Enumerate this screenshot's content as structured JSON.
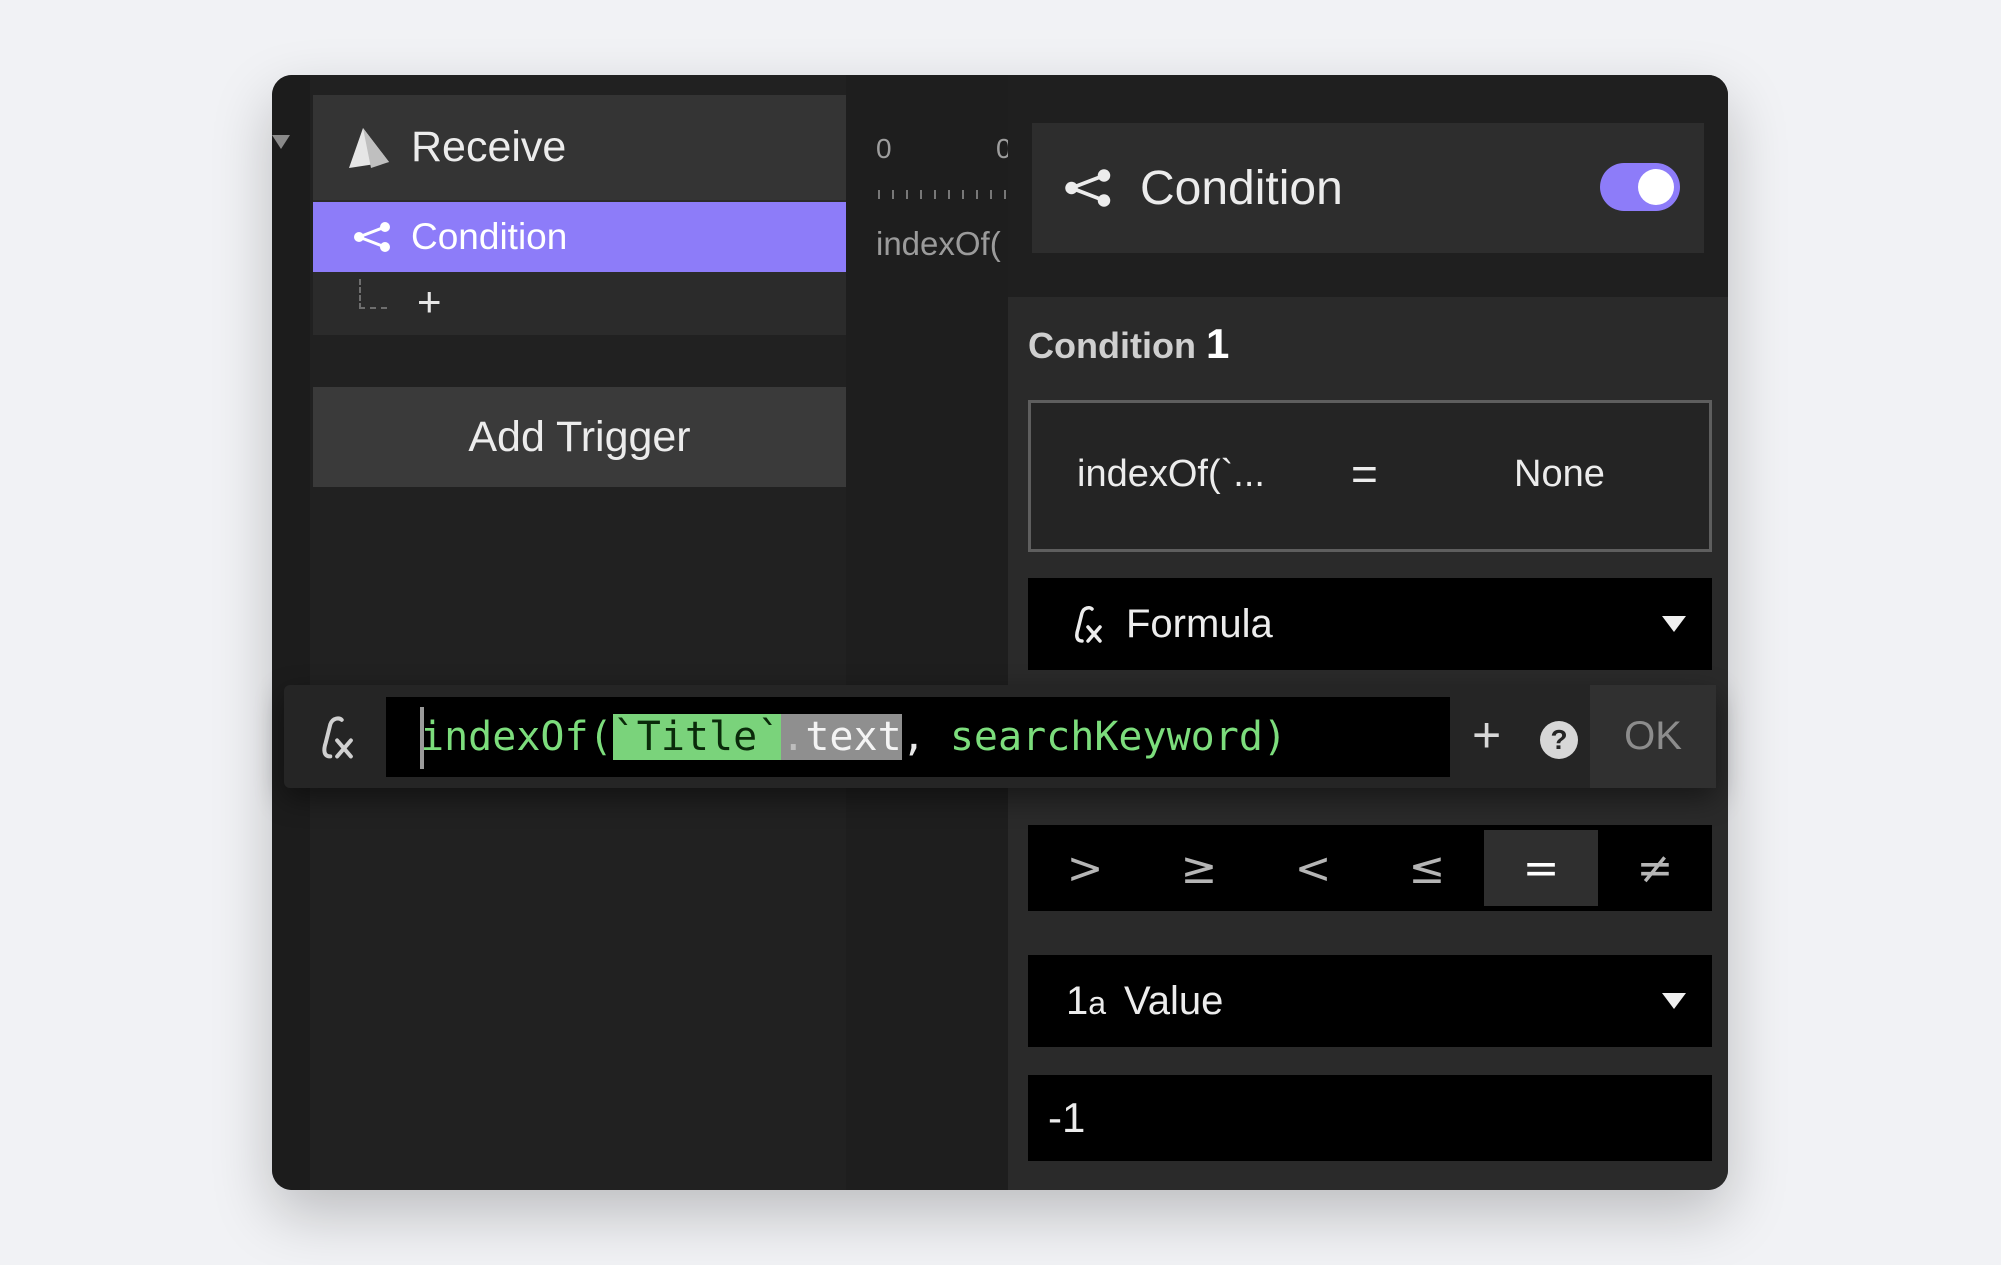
{
  "sidebar": {
    "trigger_title": "Receive",
    "action_label": "Condition",
    "add_action_glyph": "+",
    "add_trigger_label": "Add Trigger"
  },
  "middle": {
    "tick_left": "0",
    "tick_right": "0",
    "label": "indexOf("
  },
  "panel": {
    "title": "Condition",
    "enabled": true,
    "condition_heading": "Condition",
    "condition_number": "1",
    "expression": {
      "left": "indexOf(`...",
      "operator": "=",
      "right": "None"
    },
    "left_type_label": "Formula",
    "operators": [
      ">",
      "≥",
      "<",
      "≤",
      "=",
      "≠"
    ],
    "selected_operator": "=",
    "right_type_glyph": "1",
    "right_type_glyph_small": "a",
    "right_type_label": "Value",
    "value": "-1"
  },
  "formula_bar": {
    "code_fn": "indexOf(",
    "code_title": "`Title`",
    "code_dot": ".",
    "code_prop": "text",
    "code_comma": ",",
    "code_rest": " searchKeyword)",
    "add_glyph": "+",
    "help_glyph": "?",
    "ok_label": "OK"
  },
  "colors": {
    "accent": "#8d7cf9",
    "code_green": "#7cdd7c",
    "token_highlight": "#7ad37b"
  },
  "icons": [
    "receive-icon",
    "branch-icon",
    "fx-icon",
    "help-icon",
    "caret-down-icon"
  ]
}
